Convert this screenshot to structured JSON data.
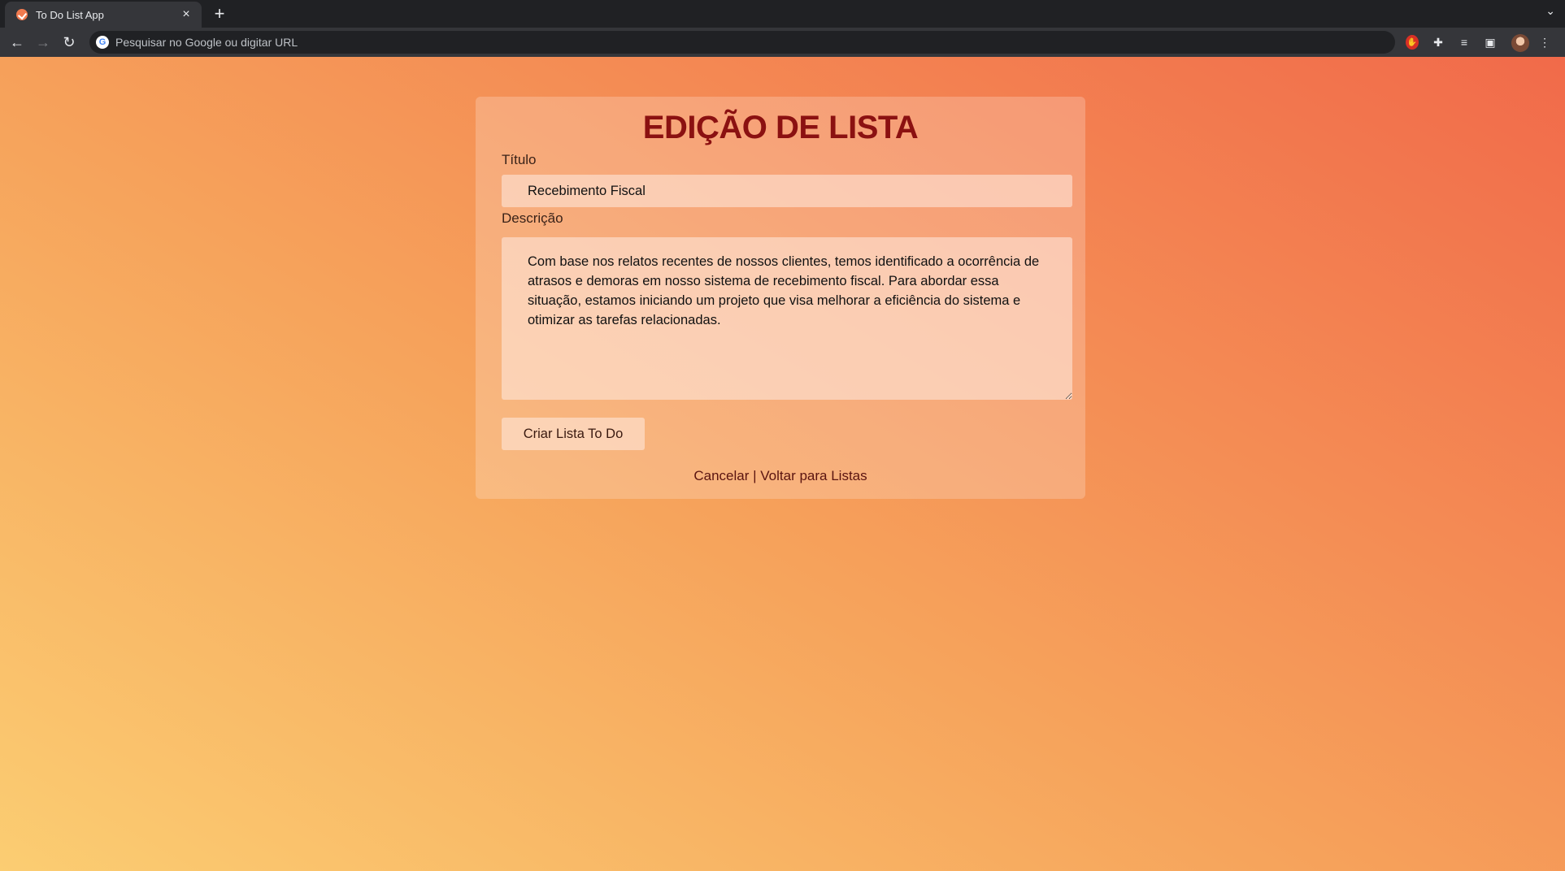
{
  "browser": {
    "tab_title": "To Do List App",
    "close_glyph": "×",
    "new_tab_glyph": "+",
    "tab_menu_glyph": "⌄",
    "back_glyph": "←",
    "forward_glyph": "→",
    "reload_glyph": "↻",
    "omnibox_placeholder": "Pesquisar no Google ou digitar URL",
    "menu_glyph": "⋮"
  },
  "page": {
    "heading": "EDIÇÃO DE LISTA",
    "title_label": "Título",
    "title_value": "Recebimento Fiscal",
    "description_label": "Descrição",
    "description_value": "Com base nos relatos recentes de nossos clientes, temos identificado a ocorrência de atrasos e demoras em nosso sistema de recebimento fiscal. Para abordar essa situação, estamos iniciando um projeto que visa melhorar a eficiência do sistema e otimizar as tarefas relacionadas.",
    "submit_label": "Criar Lista To Do",
    "cancel_link": "Cancelar",
    "separator": " | ",
    "back_link": "Voltar para Listas"
  },
  "colors": {
    "heading": "#8b1111",
    "gradient_start": "#fbcd72",
    "gradient_end": "#f16a4a"
  },
  "icons": [
    "favicon-check-icon",
    "close-icon",
    "plus-icon",
    "back-arrow-icon",
    "forward-arrow-icon",
    "reload-icon",
    "google-icon",
    "extension-red-icon",
    "puzzle-icon",
    "reading-list-icon",
    "side-panel-icon",
    "avatar",
    "kebab-menu-icon"
  ]
}
